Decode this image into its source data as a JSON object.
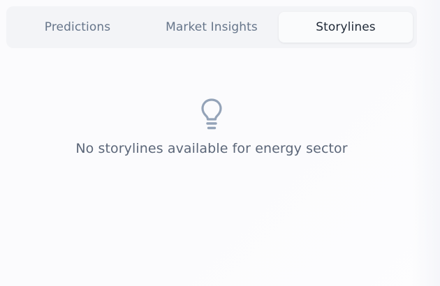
{
  "tabs": [
    {
      "label": "Predictions",
      "active": false
    },
    {
      "label": "Market Insights",
      "active": false
    },
    {
      "label": "Storylines",
      "active": true
    }
  ],
  "empty_state": {
    "icon": "lightbulb-icon",
    "message": "No storylines available for energy sector"
  },
  "colors": {
    "active_tab_text": "#1f2937",
    "inactive_tab_text": "#66758a",
    "icon": "#94a3b8"
  }
}
